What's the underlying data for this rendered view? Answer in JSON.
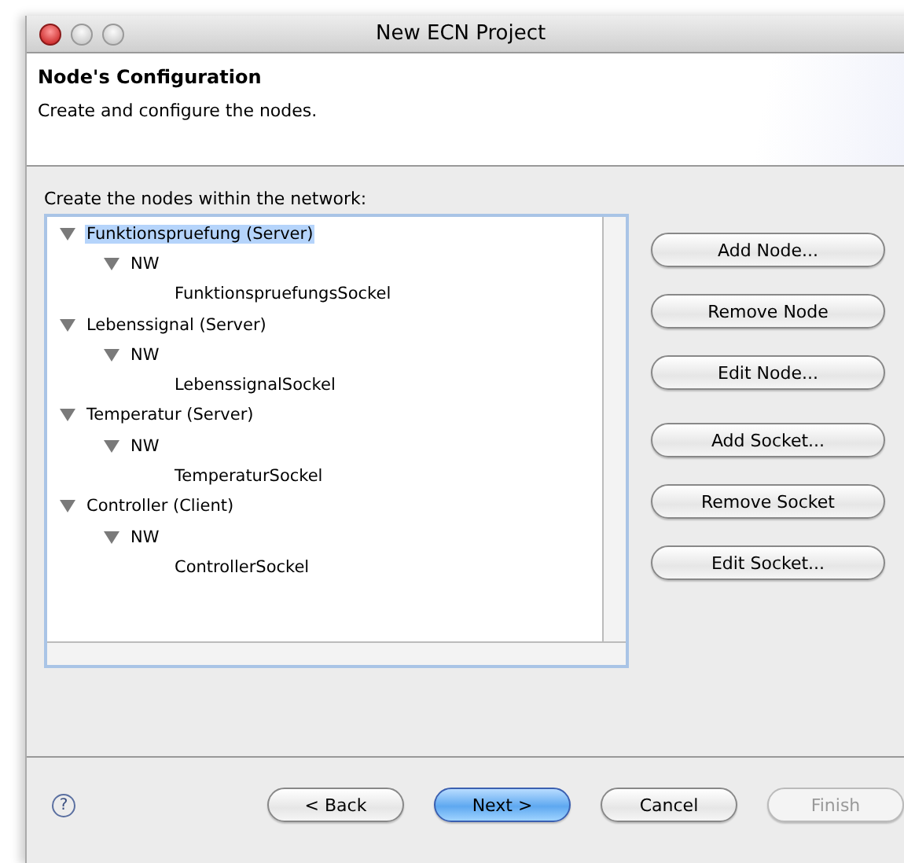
{
  "window": {
    "title": "New ECN Project"
  },
  "header": {
    "title": "Node's Configuration",
    "description": "Create and configure the nodes."
  },
  "tree_label": "Create the nodes within the network:",
  "tree": [
    {
      "label": "Funktionspruefung (Server)",
      "expanded": true,
      "selected": true,
      "children": [
        {
          "label": "NW",
          "expanded": true,
          "selected": false,
          "children": [
            {
              "label": "FunktionspruefungsSockel",
              "selected": false
            }
          ]
        }
      ]
    },
    {
      "label": "Lebenssignal (Server)",
      "expanded": true,
      "selected": false,
      "children": [
        {
          "label": "NW",
          "expanded": true,
          "selected": false,
          "children": [
            {
              "label": "LebenssignalSockel",
              "selected": false
            }
          ]
        }
      ]
    },
    {
      "label": "Temperatur (Server)",
      "expanded": true,
      "selected": false,
      "children": [
        {
          "label": "NW",
          "expanded": true,
          "selected": false,
          "children": [
            {
              "label": "TemperaturSockel",
              "selected": false
            }
          ]
        }
      ]
    },
    {
      "label": "Controller (Client)",
      "expanded": true,
      "selected": false,
      "children": [
        {
          "label": "NW",
          "expanded": true,
          "selected": false,
          "children": [
            {
              "label": "ControllerSockel",
              "selected": false
            }
          ]
        }
      ]
    }
  ],
  "side_button_groups": [
    [
      "Add Node...",
      "Remove Node",
      "Edit Node..."
    ],
    [
      "Add Socket...",
      "Remove Socket",
      "Edit Socket..."
    ]
  ],
  "help": "?",
  "footer_buttons": [
    {
      "label": "< Back",
      "default": false,
      "disabled": false
    },
    {
      "label": "Next >",
      "default": true,
      "disabled": false
    },
    {
      "label": "Cancel",
      "default": false,
      "disabled": false
    },
    {
      "label": "Finish",
      "default": false,
      "disabled": true
    }
  ]
}
